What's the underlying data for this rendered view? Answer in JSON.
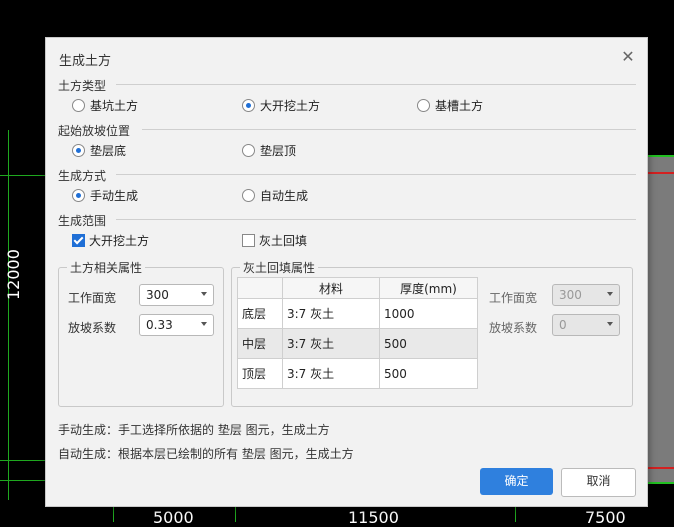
{
  "dialog": {
    "title": "生成土方",
    "sections": {
      "soil_type": {
        "label": "土方类型",
        "options": [
          "基坑土方",
          "大开挖土方",
          "基槽土方"
        ]
      },
      "start_position": {
        "label": "起始放坡位置",
        "options": [
          "垫层底",
          "垫层顶"
        ]
      },
      "method": {
        "label": "生成方式",
        "options": [
          "手动生成",
          "自动生成"
        ]
      },
      "range": {
        "label": "生成范围",
        "options": [
          "大开挖土方",
          "灰土回填"
        ]
      }
    },
    "soil_props": {
      "title": "土方相关属性",
      "work_width_label": "工作面宽",
      "work_width_value": "300",
      "slope_label": "放坡系数",
      "slope_value": "0.33"
    },
    "backfill_props": {
      "title": "灰土回填属性",
      "headers": [
        "",
        "材料",
        "厚度(mm)"
      ],
      "rows": [
        {
          "layer": "底层",
          "material": "3:7 灰土",
          "thickness": "1000"
        },
        {
          "layer": "中层",
          "material": "3:7 灰土",
          "thickness": "500"
        },
        {
          "layer": "顶层",
          "material": "3:7 灰土",
          "thickness": "500"
        }
      ],
      "work_width_label": "工作面宽",
      "work_width_value": "300",
      "slope_label": "放坡系数",
      "slope_value": "0"
    },
    "notes": [
      "手动生成：手工选择所依据的 垫层 图元，生成土方",
      "自动生成：根据本层已绘制的所有 垫层 图元，生成土方"
    ],
    "buttons": {
      "ok": "确定",
      "cancel": "取消"
    }
  },
  "cad": {
    "left_dim": "12000",
    "bottom_dims": [
      "5000",
      "11500",
      "7500"
    ]
  },
  "colors": {
    "accent": "#2f80de",
    "cad_line": "#1fa81f"
  }
}
